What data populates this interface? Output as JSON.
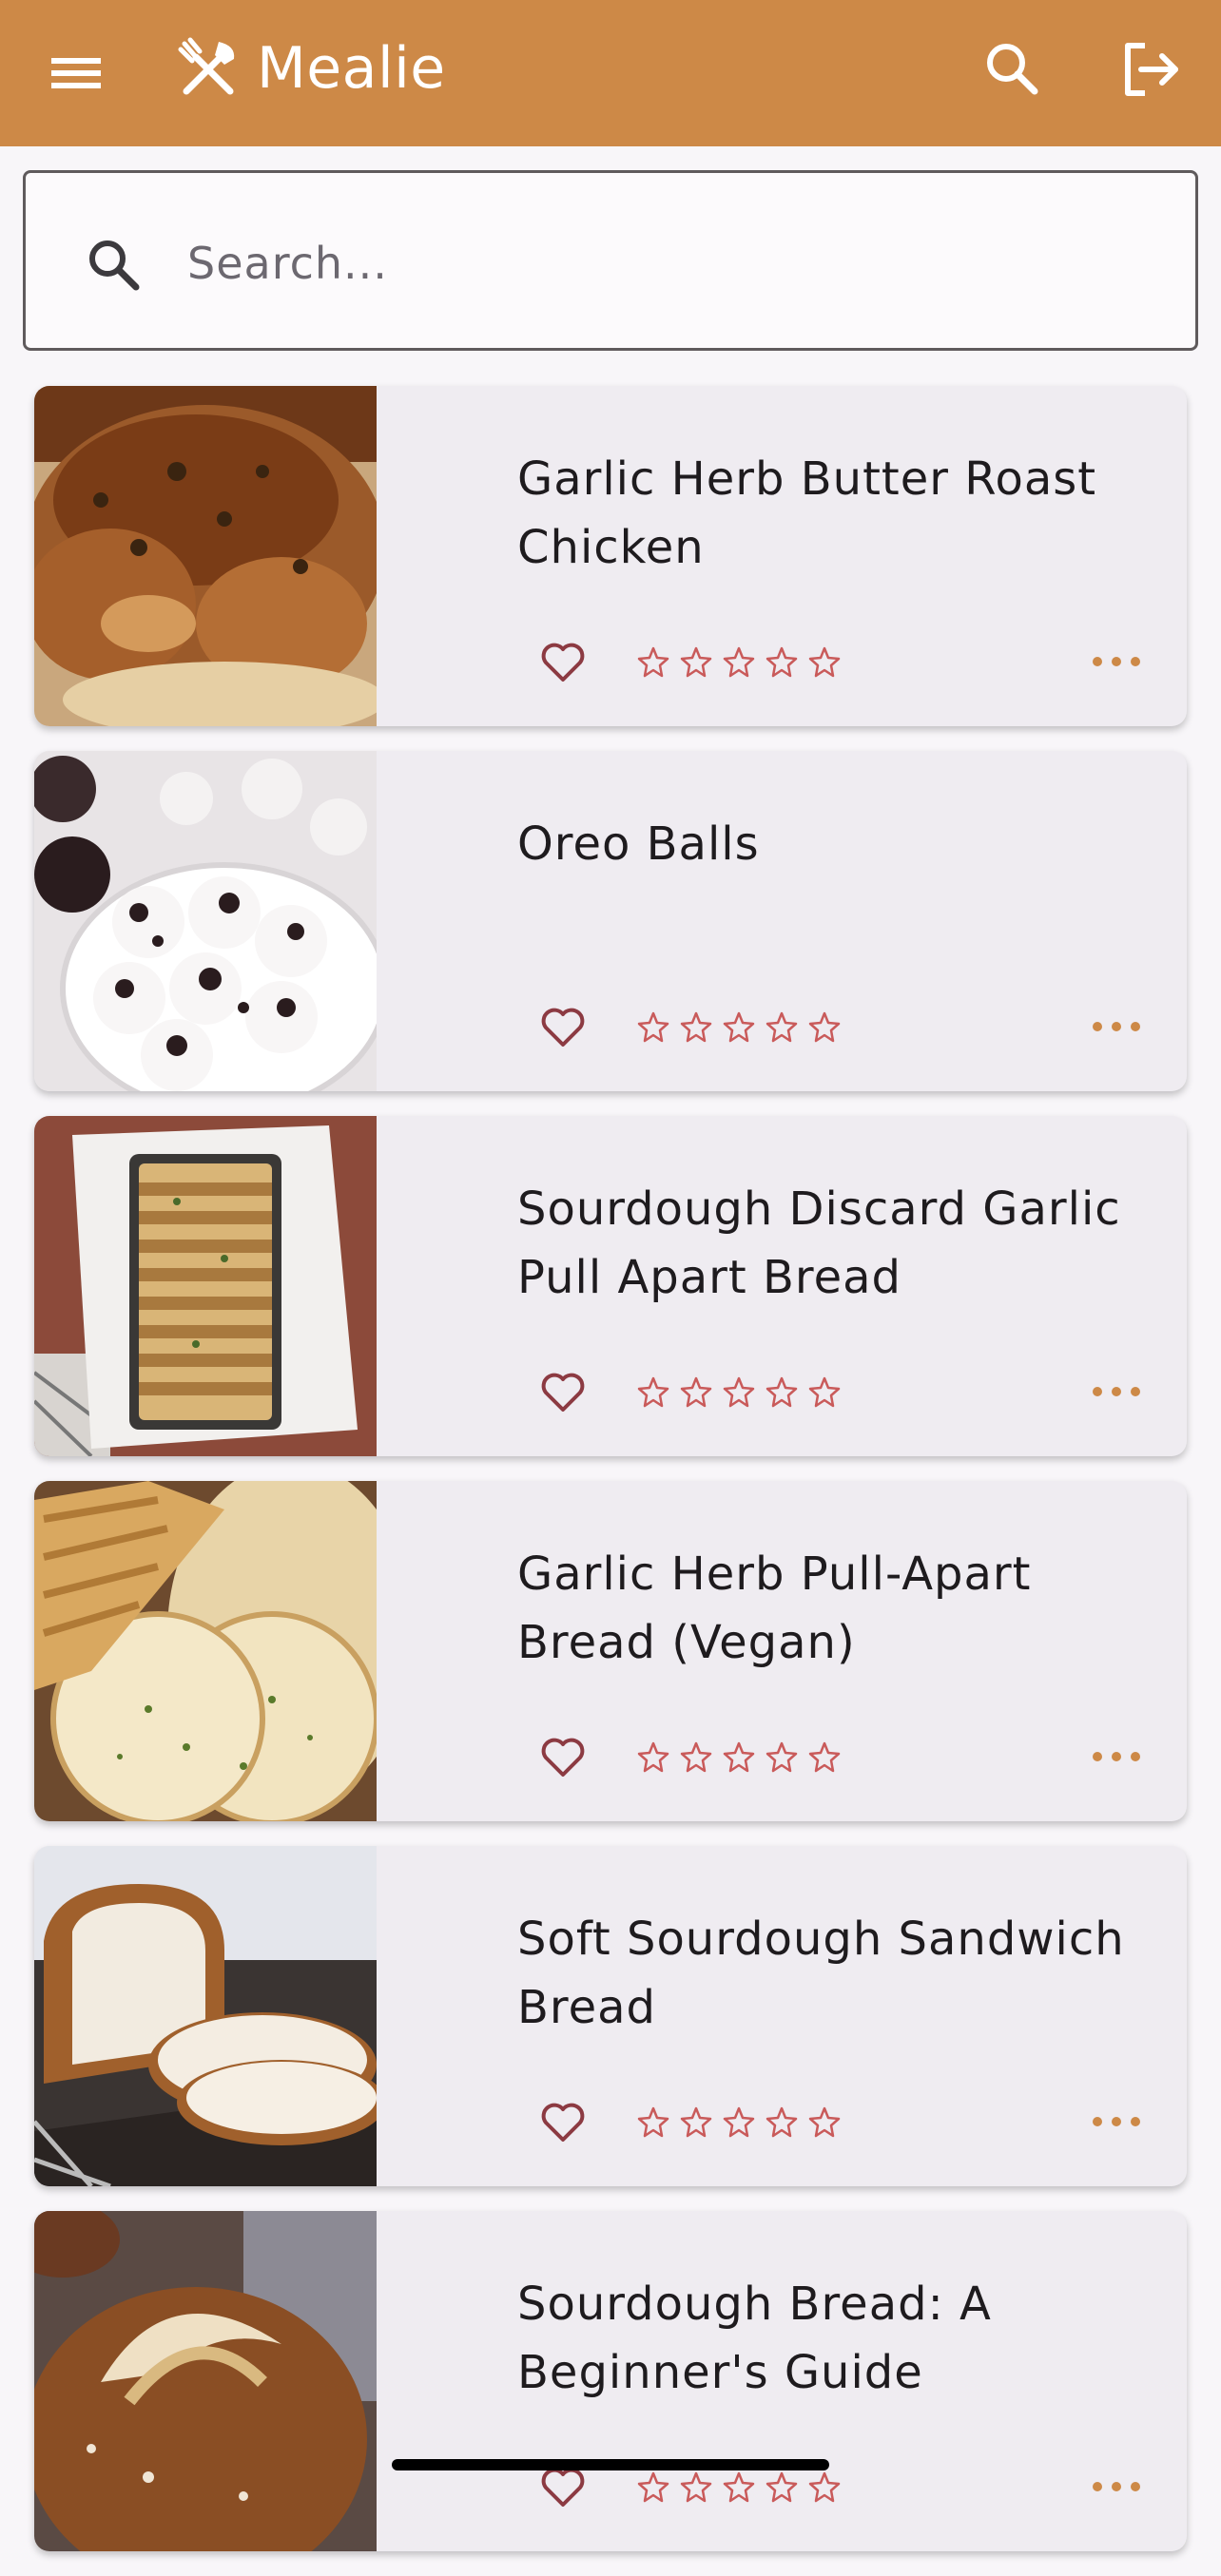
{
  "app": {
    "title": "Mealie",
    "accent_color": "#cd8947",
    "header_icons": [
      "menu-icon",
      "utensils-logo-icon",
      "search-icon",
      "logout-icon"
    ]
  },
  "search": {
    "placeholder": "Search...",
    "value": ""
  },
  "recipes": [
    {
      "name": "Garlic Herb Butter Roast Chicken",
      "favorite": false,
      "rating": 0,
      "rating_max": 5
    },
    {
      "name": "Oreo Balls",
      "favorite": false,
      "rating": 0,
      "rating_max": 5
    },
    {
      "name": "Sourdough Discard Garlic Pull Apart Bread",
      "favorite": false,
      "rating": 0,
      "rating_max": 5
    },
    {
      "name": "Garlic Herb Pull-Apart Bread (Vegan)",
      "favorite": false,
      "rating": 0,
      "rating_max": 5
    },
    {
      "name": "Soft Sourdough Sandwich Bread",
      "favorite": false,
      "rating": 0,
      "rating_max": 5
    },
    {
      "name": "Sourdough Bread: A Beginner's Guide",
      "favorite": false,
      "rating": 0,
      "rating_max": 5
    }
  ],
  "colors": {
    "heart": "#8c3a42",
    "star": "#c95a5a",
    "more_dots": "#cd8947"
  }
}
